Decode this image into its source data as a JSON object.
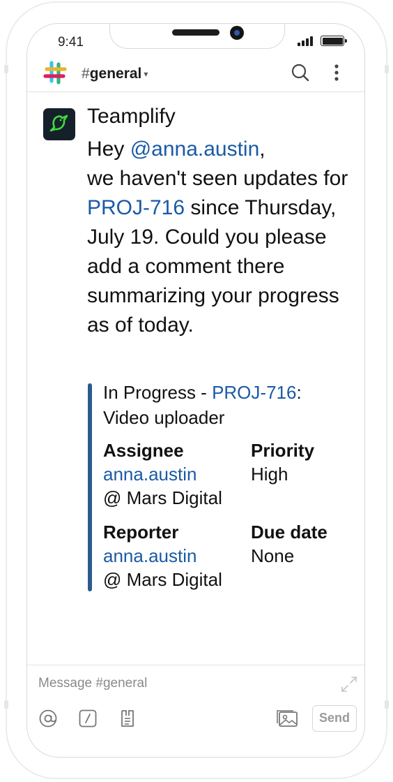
{
  "status_bar": {
    "time": "9:41"
  },
  "header": {
    "channel_name": "general",
    "hash": "#",
    "chevron": "▾"
  },
  "message": {
    "sender": "Teamplify",
    "greeting": "Hey ",
    "mention": "@anna.austin",
    "comma": ",",
    "line_before_proj": "we haven't seen updates for ",
    "proj_link": "PROJ-716",
    "text_after_proj": " since Thursday, July 19. Could you please add a comment there summarizing your progress as of today."
  },
  "attachment": {
    "status_prefix": "In Progress - ",
    "proj_link": "PROJ-716",
    "title_suffix": ":",
    "task_title": "Video uploader",
    "assignee": {
      "label": "Assignee",
      "user": "anna.austin",
      "org": "@ Mars Digital"
    },
    "priority": {
      "label": "Priority",
      "value": "High"
    },
    "reporter": {
      "label": "Reporter",
      "user": "anna.austin",
      "org": "@ Mars Digital"
    },
    "due_date": {
      "label": "Due date",
      "value": "None"
    }
  },
  "composer": {
    "placeholder": "Message #general",
    "send_label": "Send"
  },
  "icons": {
    "logo": "slack-logo",
    "search": "search-icon",
    "more": "kebab-icon",
    "mention": "at-icon",
    "slash": "slash-command-icon",
    "file": "file-icon",
    "image": "image-icon",
    "expand": "expand-icon"
  },
  "colors": {
    "link": "#1a5aa6",
    "attachment_bar": "#2d5a8e",
    "avatar_bg": "#16202b",
    "avatar_bird": "#3fdc3c"
  }
}
